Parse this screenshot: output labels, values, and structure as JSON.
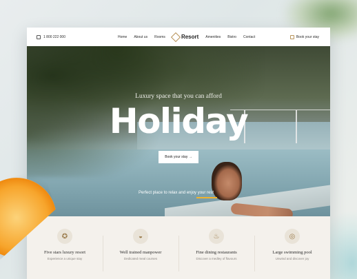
{
  "header": {
    "phone": "1 800 222 000",
    "nav_left": [
      "Home",
      "About us",
      "Rooms"
    ],
    "brand": "Resort",
    "nav_right": [
      "Amenities",
      "Bistro",
      "Contact"
    ],
    "book_label": "Book your stay"
  },
  "hero": {
    "tagline": "Luxury space that you can afford",
    "headline": "Holiday",
    "button_label": "Book your stay →",
    "subline": "Perfect place to relax and enjoy your rest"
  },
  "features": [
    {
      "icon": "award-icon",
      "title": "Five stars luxury resort",
      "desc": "Experience a unique stay"
    },
    {
      "icon": "dish-icon",
      "title": "Well trained manpower",
      "desc": "Dedicated meal courses"
    },
    {
      "icon": "chef-hat-icon",
      "title": "Fine dining restaurants",
      "desc": "Discover a medley of flavours"
    },
    {
      "icon": "lifebuoy-icon",
      "title": "Large swimming pool",
      "desc": "Unwind and discover joy"
    }
  ],
  "colors": {
    "accent": "#b8935a",
    "underline": "#f2b32c",
    "features_bg": "#f4f1ec"
  }
}
